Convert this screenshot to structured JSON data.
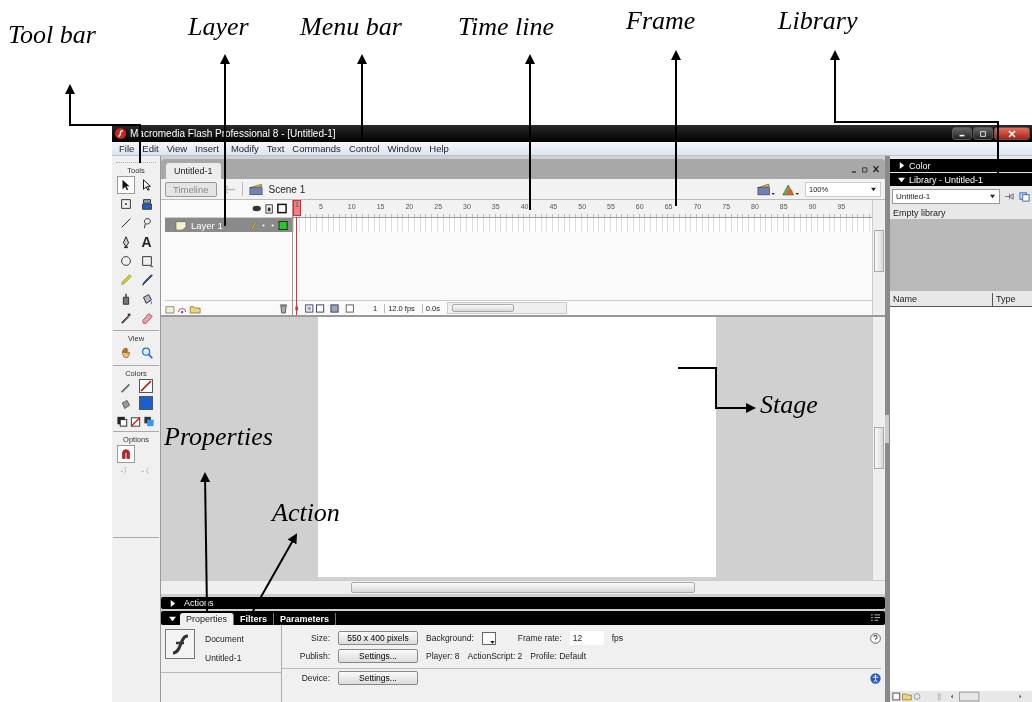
{
  "annotations": [
    {
      "label": "Tool bar"
    },
    {
      "label": "Layer"
    },
    {
      "label": "Menu bar"
    },
    {
      "label": "Time line"
    },
    {
      "label": "Frame"
    },
    {
      "label": "Library"
    },
    {
      "label": "Stage"
    },
    {
      "label": "Properties"
    },
    {
      "label": "Action"
    }
  ],
  "window": {
    "title": "Macromedia Flash Professional 8 - [Untitled-1]"
  },
  "menu": [
    "File",
    "Edit",
    "View",
    "Insert",
    "Modify",
    "Text",
    "Commands",
    "Control",
    "Window",
    "Help"
  ],
  "tools": {
    "title": "Tools",
    "items": [
      {
        "kind": "arrow",
        "selected": true
      },
      {
        "kind": "subselect",
        "selected": false
      },
      {
        "kind": "transform",
        "selected": false
      },
      {
        "kind": "gradient",
        "selected": false
      },
      {
        "kind": "line",
        "selected": false
      },
      {
        "kind": "lasso",
        "selected": false
      },
      {
        "kind": "pen",
        "selected": false
      },
      {
        "kind": "text",
        "glyph": "A",
        "selected": false
      },
      {
        "kind": "oval",
        "selected": false
      },
      {
        "kind": "rect",
        "selected": false
      },
      {
        "kind": "pencil",
        "selected": false
      },
      {
        "kind": "brush",
        "selected": false
      },
      {
        "kind": "ink",
        "selected": false
      },
      {
        "kind": "bucket",
        "selected": false
      },
      {
        "kind": "dropper",
        "selected": false
      },
      {
        "kind": "eraser",
        "selected": false
      }
    ],
    "view_label": "View",
    "colors_label": "Colors",
    "options_label": "Options"
  },
  "document": {
    "tab": "Untitled-1",
    "timeline_button": "Timeline",
    "scene": "Scene 1",
    "zoom": "100%"
  },
  "timeline": {
    "frame_numbers": [
      "1",
      "5",
      "10",
      "15",
      "20",
      "25",
      "30",
      "35",
      "40",
      "45",
      "50",
      "55",
      "60",
      "65",
      "70",
      "75",
      "80",
      "85",
      "90",
      "95"
    ],
    "layers": [
      {
        "name": "Layer 1",
        "selected": true
      }
    ],
    "current_frame": "1",
    "frame_rate": "12.0 fps",
    "elapsed": "0.0s"
  },
  "actions_panel": {
    "label": "Actions",
    "expanded": false
  },
  "properties": {
    "expanded": true,
    "tabs": [
      {
        "label": "Properties",
        "selected": true
      },
      {
        "label": "Filters",
        "selected": false
      },
      {
        "label": "Parameters",
        "selected": false
      }
    ],
    "doc_type": "Document",
    "doc_name": "Untitled-1",
    "size_label": "Size:",
    "size_value": "550 x 400 pixels",
    "background_label": "Background:",
    "frame_rate_label": "Frame rate:",
    "frame_rate": "12",
    "fps": "fps",
    "publish_label": "Publish:",
    "publish_button": "Settings...",
    "player": "Player: 8",
    "actionscript": "ActionScript: 2",
    "profile": "Profile: Default",
    "device_label": "Device:",
    "device_button": "Settings..."
  },
  "color_panel": {
    "label": "Color",
    "expanded": false
  },
  "library": {
    "title": "Library - Untitled-1",
    "expanded": true,
    "document": "Untitled-1",
    "status": "Empty library",
    "columns": [
      "Name",
      "Type"
    ]
  }
}
